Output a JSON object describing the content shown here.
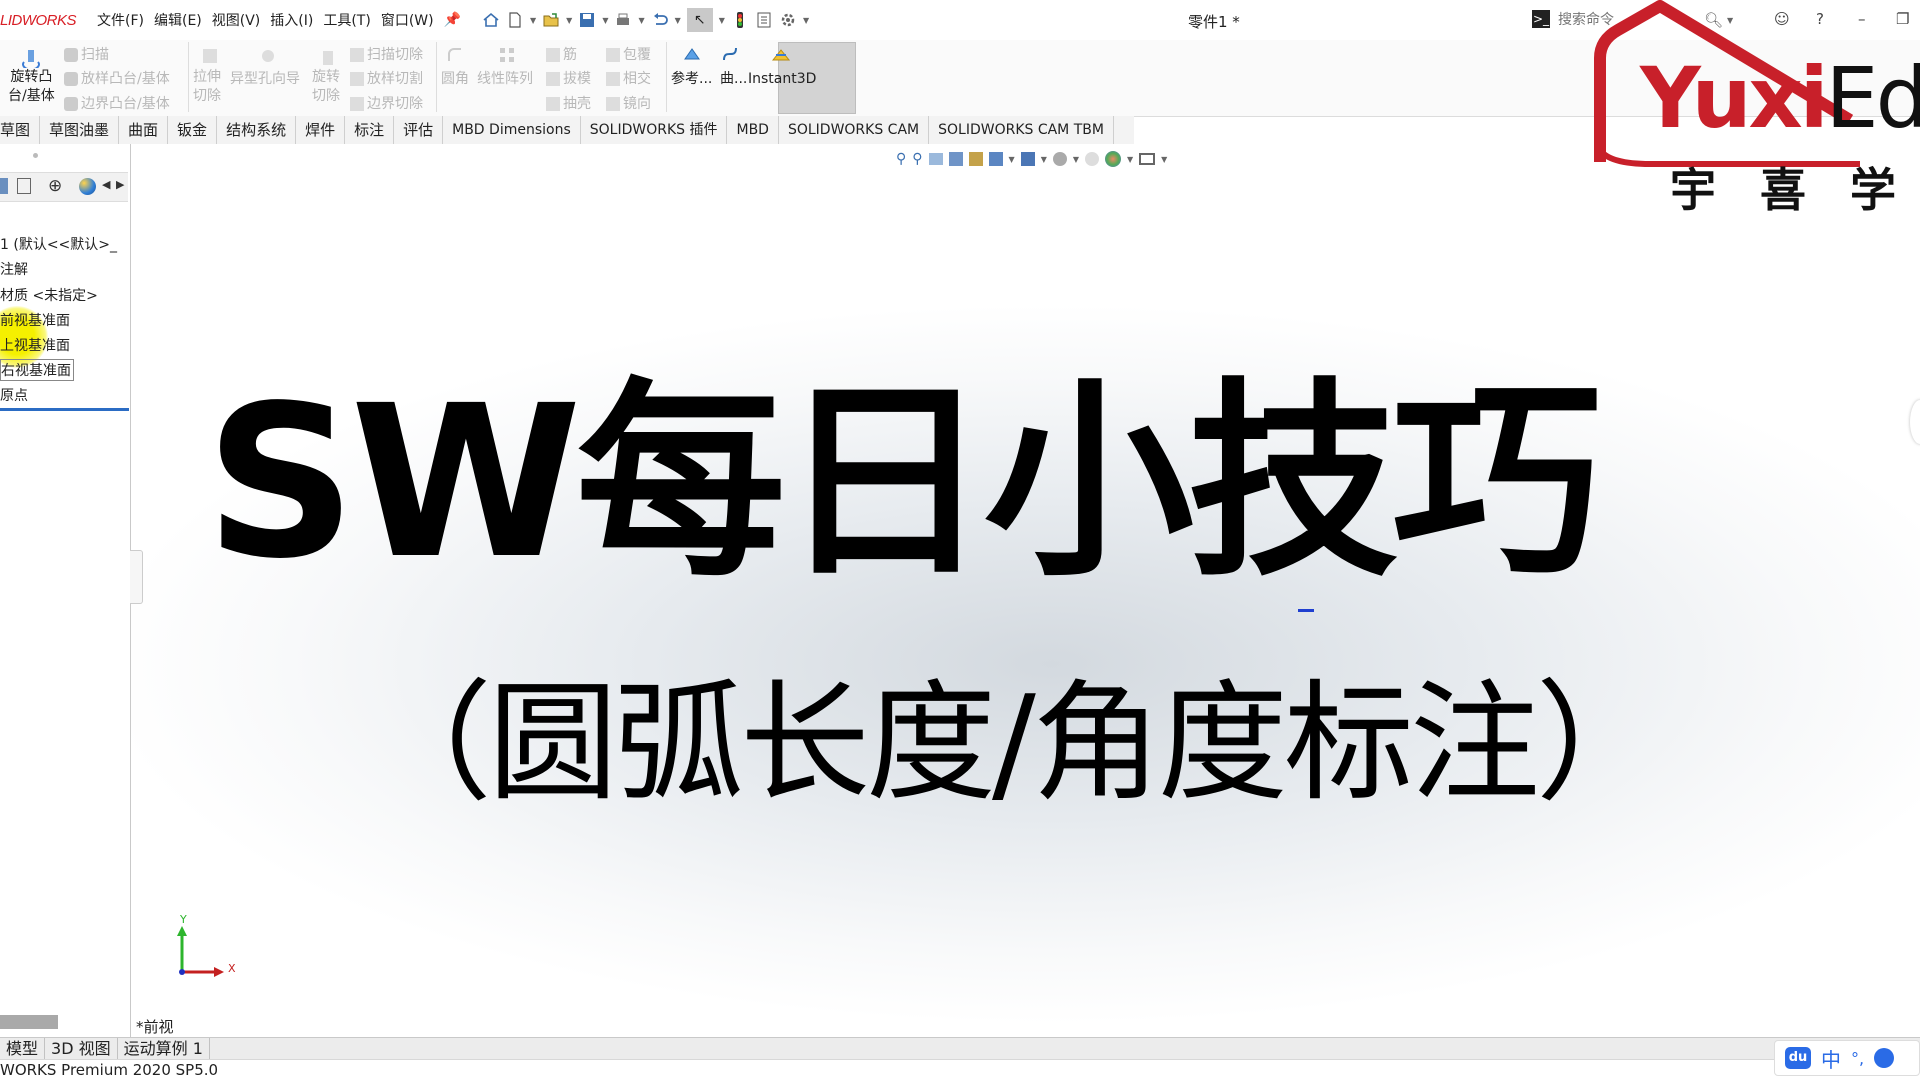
{
  "app": {
    "logo": "LIDWORKS",
    "doc_title": "零件1 *"
  },
  "menu": [
    "文件(F)",
    "编辑(E)",
    "视图(V)",
    "插入(I)",
    "工具(T)",
    "窗口(W)"
  ],
  "search": {
    "placeholder": "搜索命令"
  },
  "toolbar": {
    "revolve_boss": [
      "旋转凸",
      "台/基体"
    ],
    "sweep": "扫描",
    "loft_boss": "放样凸台/基体",
    "boundary_boss": "边界凸台/基体",
    "extrude_cut": [
      "拉伸",
      "切除"
    ],
    "hole_wizard": "异型孔向导",
    "revolve_cut": [
      "旋转",
      "切除"
    ],
    "sweep_cut": "扫描切除",
    "loft_cut": "放样切割",
    "boundary_cut": "边界切除",
    "fillet": "圆角",
    "linear_pattern": "线性阵列",
    "rib": "筋",
    "draft": "拔模",
    "shell": "抽壳",
    "wrap": "包覆",
    "intersect": "相交",
    "mirror": "镜向",
    "ref_geometry": "参考...",
    "curves": "曲...",
    "instant3d": "Instant3D"
  },
  "tabs": [
    "草图",
    "草图油墨",
    "曲面",
    "钣金",
    "结构系统",
    "焊件",
    "标注",
    "评估",
    "MBD Dimensions",
    "SOLIDWORKS 插件",
    "MBD",
    "SOLIDWORKS CAM",
    "SOLIDWORKS CAM TBM"
  ],
  "tree": {
    "part": "1 (默认<<默认>_",
    "annotations": "注解",
    "material": "材质 <未指定>",
    "front_plane": "前视基准面",
    "top_plane": "上视基准面",
    "right_plane": "右视基准面",
    "origin": "原点"
  },
  "overlay": {
    "headline": "SW每日小技巧",
    "subline": "（圆弧长度/角度标注）"
  },
  "view": {
    "label": "*前视",
    "axis_x": "X",
    "axis_y": "Y"
  },
  "bottom_tabs": [
    "模型",
    "3D 视图",
    "运动算例 1"
  ],
  "status": {
    "text": "WORKS Premium 2020 SP5.0"
  },
  "watermark": {
    "brand_a": "Yuxi",
    "brand_b": "Ed",
    "cn": "宇 喜 学 院"
  },
  "ime": {
    "lang": "中",
    "punct": "°,"
  },
  "colors": {
    "accent": "#d81f26",
    "brand_red": "#c8202a",
    "highlight": "#f5f000",
    "ime_blue": "#2a6be6"
  }
}
